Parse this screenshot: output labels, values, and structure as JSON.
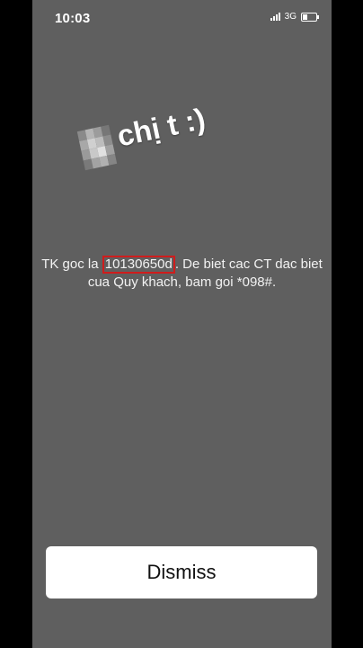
{
  "status_bar": {
    "time": "10:03",
    "network": "3G",
    "icons": [
      "signal-icon",
      "battery-icon"
    ]
  },
  "sticker": {
    "text": "chị t :)"
  },
  "message": {
    "prefix": "TK goc la ",
    "highlighted": "10130650d",
    "suffix_line1": ". De biet cac CT dac biet",
    "line2": "cua Quy khach, bam goi *098#.",
    "highlight_color": "#d01c1c"
  },
  "dismiss_label": "Dismiss"
}
